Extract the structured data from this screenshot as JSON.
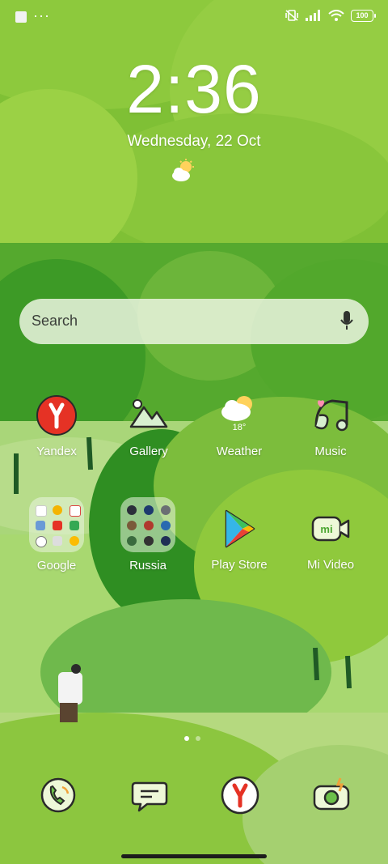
{
  "status_bar": {
    "battery": "100",
    "more": "···"
  },
  "clock": {
    "time": "2:36",
    "date": "Wednesday, 22 Oct"
  },
  "search": {
    "placeholder": "Search"
  },
  "apps": [
    {
      "label": "Yandex"
    },
    {
      "label": "Gallery"
    },
    {
      "label": "Weather",
      "temp": "18°"
    },
    {
      "label": "Music"
    },
    {
      "label": "Google"
    },
    {
      "label": "Russia"
    },
    {
      "label": "Play Store"
    },
    {
      "label": "Mi Video"
    }
  ],
  "dock": [
    "phone-icon",
    "messages-icon",
    "yandex-browser-icon",
    "camera-icon"
  ],
  "pager": {
    "pages": 2,
    "current": 1
  },
  "colors": {
    "grass": "#86c23c",
    "tree_dark": "#3f9d2a",
    "tree_light": "#9ad246",
    "yandex_red": "#e53225"
  }
}
